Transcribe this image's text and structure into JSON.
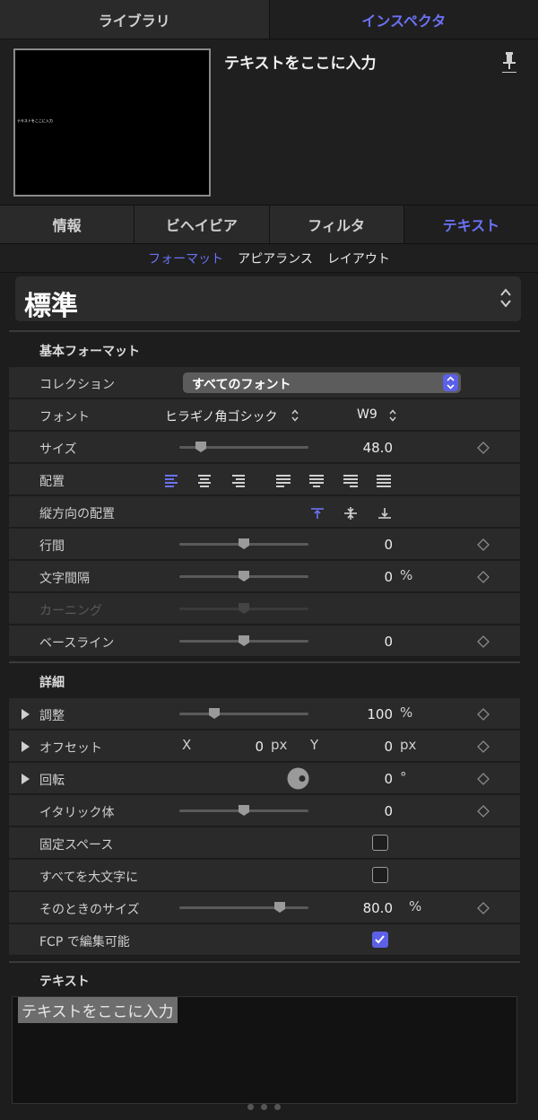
{
  "top_tabs": [
    {
      "label": "ライブラリ"
    },
    {
      "label": "インスペクタ"
    }
  ],
  "header": {
    "title": "テキストをここに入力",
    "thumbnail_text": "テキストをここに入力"
  },
  "sub_tabs": [
    {
      "label": "情報"
    },
    {
      "label": "ビヘイビア"
    },
    {
      "label": "フィルタ"
    },
    {
      "label": "テキスト"
    }
  ],
  "segments": [
    {
      "label": "フォーマット"
    },
    {
      "label": "アピアランス"
    },
    {
      "label": "レイアウト"
    }
  ],
  "preset": {
    "label": "標準"
  },
  "basic_format": {
    "title": "基本フォーマット",
    "collection": {
      "label": "コレクション",
      "value": "すべてのフォント"
    },
    "font": {
      "label": "フォント",
      "family": "ヒラギノ角ゴシック",
      "weight": "W9"
    },
    "size": {
      "label": "サイズ",
      "value": "48.0",
      "slider_fraction": 0.17
    },
    "alignment": {
      "label": "配置",
      "selected": "left"
    },
    "vertical_alignment": {
      "label": "縦方向の配置",
      "selected": "top"
    },
    "line_spacing": {
      "label": "行間",
      "value": "0",
      "slider_fraction": 0.5
    },
    "tracking": {
      "label": "文字間隔",
      "value": "0",
      "unit": "%",
      "slider_fraction": 0.5
    },
    "kerning": {
      "label": "カーニング",
      "slider_fraction": 0.5
    },
    "baseline": {
      "label": "ベースライン",
      "value": "0",
      "slider_fraction": 0.5
    }
  },
  "advanced": {
    "title": "詳細",
    "scale": {
      "label": "調整",
      "value": "100",
      "unit": "%",
      "slider_fraction": 0.27
    },
    "offset": {
      "label": "オフセット",
      "x_label": "X",
      "x_value": "0",
      "x_unit": "px",
      "y_label": "Y",
      "y_value": "0",
      "y_unit": "px"
    },
    "rotation": {
      "label": "回転",
      "value": "0",
      "unit": "°"
    },
    "slant": {
      "label": "イタリック体",
      "value": "0",
      "slider_fraction": 0.5
    },
    "monospace": {
      "label": "固定スペース",
      "checked": false
    },
    "all_caps": {
      "label": "すべてを大文字に",
      "checked": false
    },
    "all_caps_size": {
      "label": "そのときのサイズ",
      "value": "80.0",
      "unit": "%",
      "slider_fraction": 0.78
    },
    "fcp_editable": {
      "label": "FCP で編集可能",
      "checked": true
    }
  },
  "text_section": {
    "title": "テキスト",
    "content": "テキストをここに入力"
  },
  "colors": {
    "accent": "#5b60e6",
    "background": "#1d1d1d",
    "row": "#2a2a2a"
  }
}
